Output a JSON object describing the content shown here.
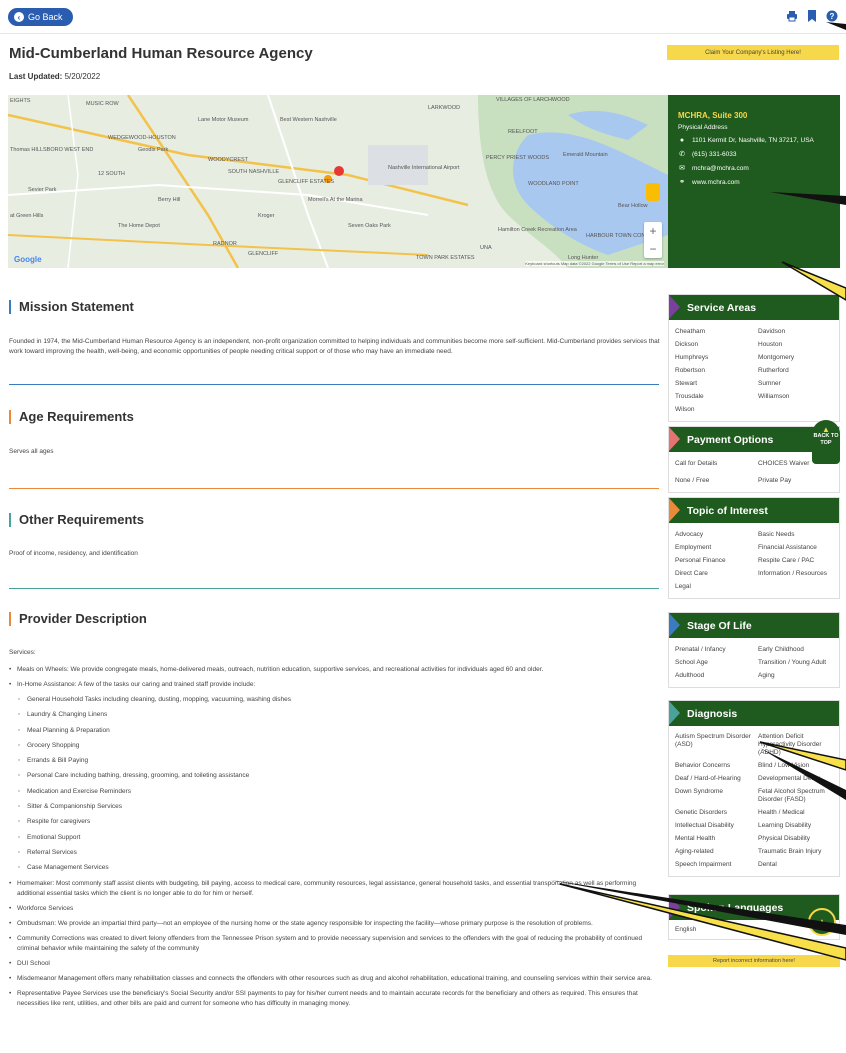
{
  "topbar": {
    "go_back_label": "Go Back",
    "icons": [
      "print-icon",
      "bookmark-icon",
      "help-icon"
    ]
  },
  "page": {
    "title": "Mid-Cumberland Human Resource Agency",
    "last_updated_label": "Last Updated:",
    "last_updated_value": "5/20/2022",
    "claim_label": "Claim Your Company's Listing Here!"
  },
  "map": {
    "labels": [
      "EIGHTS",
      "MUSIC ROW",
      "Lane Motor Museum",
      "Best Western Nashville",
      "LARKWOOD",
      "VILLAGES OF LARCHWOOD",
      "REELFOOT",
      "WEDGEWOOD-HOUSTON",
      "Thomas HILLSBORO WEST END",
      "Geodis Park",
      "WOODYCREST",
      "PERCY PRIEST WOODS",
      "Emerald Mountain",
      "SOUTH NASHVILLE",
      "12 SOUTH",
      "Nashville International Airport",
      "GLENCLIFF ESTATES",
      "WOODLAND POINT",
      "Sevier Park",
      "Berry Hill",
      "Morrell's At the Marina",
      "Bear Hollow",
      "The Home Depot",
      "Kroger",
      "Seven Oaks Park",
      "at Green Hills",
      "Hamilton Creek Recreation Area",
      "HARBOUR TOWN CONDOS",
      "RADNOR",
      "GLENCLIFF",
      "TOWN PARK ESTATES",
      "UNA",
      "Long Hunter"
    ],
    "google": "Google",
    "attribution": "Keyboard shortcuts   Map data ©2022 Google   Terms of Use   Report a map error"
  },
  "address": {
    "name": "MCHRA, Suite 300",
    "type_label": "Physical Address",
    "street": "1101 Kermit Dr, Nashville, TN 37217, USA",
    "phone": "(615) 331-6033",
    "email": "mchra@mchra.com",
    "website": "www.mchra.com"
  },
  "sections": {
    "mission": {
      "title": "Mission Statement",
      "text": "Founded in 1974, the Mid-Cumberland Human Resource Agency is an independent, non-profit organization committed to helping individuals and communities become more self-sufficient. Mid-Cumberland provides services that work toward improving the health, well-being, and economic opportunities of people needing critical support or of those who may have an immediate need."
    },
    "age": {
      "title": "Age Requirements",
      "text": "Serves all ages"
    },
    "other": {
      "title": "Other Requirements",
      "text": "Proof of income, residency, and identification"
    },
    "provider": {
      "title": "Provider Description",
      "services_label": "Services:",
      "bullets_top": [
        "Meals on Wheels:  We provide congregate meals, home-delivered meals, outreach, nutrition education, supportive services, and recreational activities for individuals aged 60 and older.",
        "In-Home Assistance:  A few of the tasks our caring and trained staff provide include:"
      ],
      "sub_items": [
        "General Household Tasks including cleaning, dusting, mopping, vacuuming,  washing dishes",
        "Laundry & Changing Linens",
        "Meal Planning & Preparation",
        "Grocery Shopping",
        "Errands & Bill Paying",
        "Personal Care including bathing, dressing, grooming, and toileting assistance",
        "Medication and Exercise Reminders",
        "Sitter & Companionship Services",
        "Respite for caregivers",
        "Emotional Support",
        "Referral Services",
        "Case Management Services"
      ],
      "bullets_bottom": [
        "Homemaker:  Most commonly staff assist clients with budgeting, bill paying, access to medical care, community resources, legal assistance, general household tasks, and essential transportation as well as performing additional essential tasks which the client is no longer able to do for him or herself.",
        "Workforce Services",
        "Ombudsman:  We provide an impartial third party—not an employee of the nursing home or the state agency responsible for inspecting the facility—whose primary purpose is the resolution of problems.",
        "Community Corrections was created to divert felony offenders from the Tennessee Prison system and to provide necessary supervision and services to the offenders with the goal of reducing the probability of continued criminal behavior while maintaining the safety of the community",
        "DUI School",
        "Misdemeanor Management offers many rehabilitation classes and connects the offenders with other resources such as drug and alcohol rehabilitation, educational training, and counseling services within their service area.",
        "Representative Payee Services use the beneficiary's Social Security and/or SSI payments to pay for his/her current needs and to maintain accurate records for the beneficiary and others as required. This ensures that necessities like rent, utilities, and other bills are paid and current for someone who has difficulty in managing money."
      ]
    }
  },
  "sidebar": {
    "service_areas": {
      "title": "Service Areas",
      "items": [
        "Cheatham",
        "Davidson",
        "Dickson",
        "Houston",
        "Humphreys",
        "Montgomery",
        "Robertson",
        "Rutherford",
        "Stewart",
        "Sumner",
        "Trousdale",
        "Williamson",
        "Wilson"
      ]
    },
    "payment": {
      "title": "Payment Options",
      "items": [
        "Call for Details",
        "CHOICES Waiver",
        "None / Free",
        "Private Pay"
      ]
    },
    "topic": {
      "title": "Topic of Interest",
      "items": [
        "Advocacy",
        "Basic Needs",
        "Employment",
        "Financial Assistance",
        "Personal Finance",
        "Respite Care / PAC",
        "Direct Care",
        "Information / Resources",
        "Legal"
      ]
    },
    "stage": {
      "title": "Stage Of Life",
      "items": [
        "Prenatal / Infancy",
        "Early Childhood",
        "School Age",
        "Transition / Young Adult",
        "Adulthood",
        "Aging"
      ]
    },
    "diagnosis": {
      "title": "Diagnosis",
      "items": [
        "Autism Spectrum Disorder (ASD)",
        "Attention Deficit Hyperactivity Disorder (ADHD)",
        "Behavior Concerns",
        "Blind / Low Vision",
        "Deaf / Hard-of-Hearing",
        "Developmental Delay",
        "Down Syndrome",
        "Fetal Alcohol Spectrum Disorder (FASD)",
        "Genetic Disorders",
        "Health / Medical",
        "Intellectual Disability",
        "Learning Disability",
        "Mental Health",
        "Physical Disability",
        "Aging-related",
        "Traumatic Brain Injury",
        "Speech Impairment",
        "Dental"
      ]
    },
    "languages": {
      "title": "Spoken Languages",
      "items": [
        "English"
      ]
    },
    "back_to_top": "BACK TO TOP",
    "report_label": "Report incorrect information here!"
  },
  "colors": {
    "brand_green": "#1f5a1e",
    "accent_yellow": "#f7d84a",
    "link_blue": "#2a5db0",
    "mission_bar": "#3b7bbf",
    "age_bar": "#e98a3a",
    "other_bar": "#4aa39b",
    "provider_bar": "#e98a3a"
  }
}
